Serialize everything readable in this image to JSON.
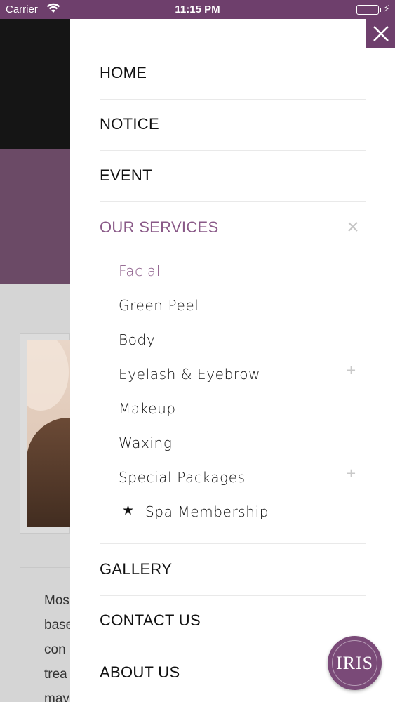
{
  "status_bar": {
    "carrier": "Carrier",
    "time": "11:15 PM",
    "battery_level": 1.0,
    "battery_color": "#4cd964",
    "wifi_icon": "wifi-icon",
    "charging_icon": "bolt-icon"
  },
  "colors": {
    "brand": "#6e3f6c",
    "active_text": "#8a5a88"
  },
  "background_page": {
    "text_lines": [
      "Mos",
      "base",
      "con",
      "trea",
      "may"
    ]
  },
  "menu": {
    "close_icon": "close-icon",
    "items": [
      {
        "label": "HOME"
      },
      {
        "label": "NOTICE"
      },
      {
        "label": "EVENT"
      },
      {
        "label": "OUR SERVICES",
        "active": true,
        "expanded": true
      },
      {
        "label": "GALLERY"
      },
      {
        "label": "CONTACT US"
      },
      {
        "label": "ABOUT US"
      }
    ],
    "services_submenu": [
      {
        "label": "Facial",
        "active": true
      },
      {
        "label": "Green Peel"
      },
      {
        "label": "Body"
      },
      {
        "label": "Eyelash & Eyebrow",
        "expandable": true
      },
      {
        "label": "Makeup"
      },
      {
        "label": "Waxing"
      },
      {
        "label": "Special Packages",
        "expandable": true
      },
      {
        "label": "Spa Membership",
        "icon": "star-icon"
      }
    ],
    "expand_symbol": "+",
    "star_symbol": "★"
  },
  "logo": {
    "text": "IRIS"
  }
}
